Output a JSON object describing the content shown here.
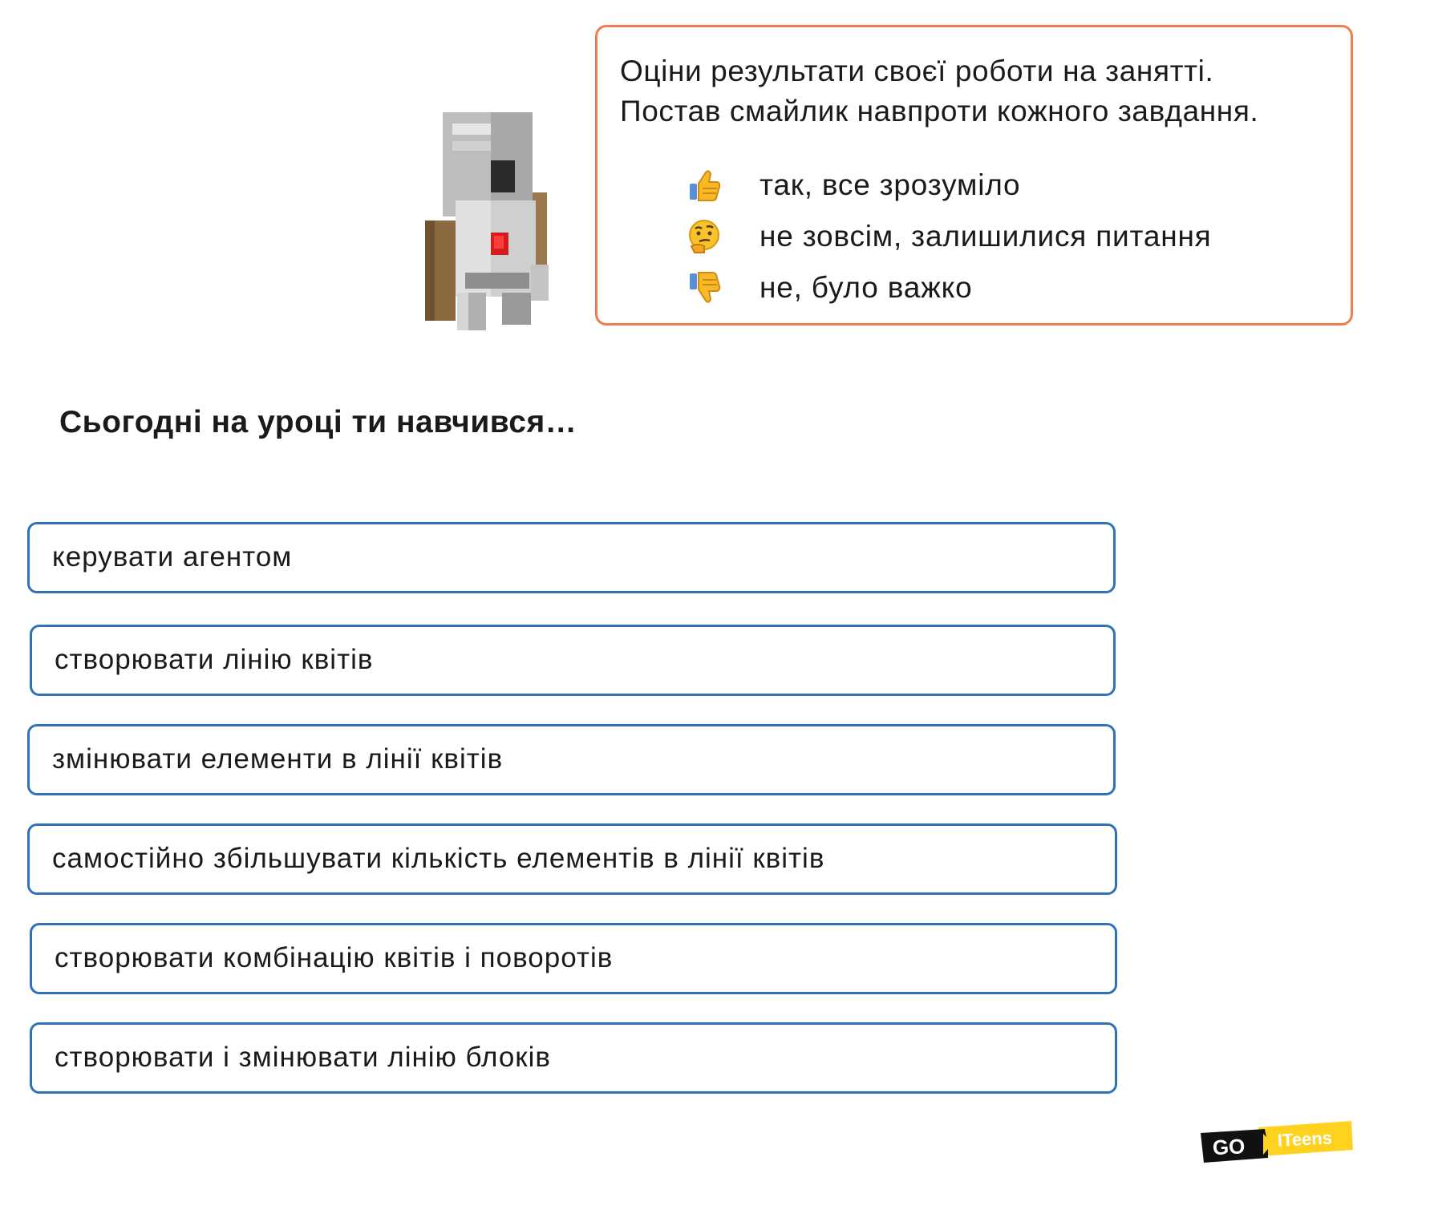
{
  "instructions": {
    "line1": "Оціни результати своєї роботи на занятті.",
    "line2": "Постав смайлик навпроти кожного завдання.",
    "legend": [
      {
        "icon": "thumbs-up-icon",
        "text": "так, все зрозуміло"
      },
      {
        "icon": "thinking-face-icon",
        "text": "не зовсім, залишилися питання"
      },
      {
        "icon": "thumbs-down-icon",
        "text": "не, було важко"
      }
    ]
  },
  "heading": "Сьогодні на уроці ти навчився…",
  "items": [
    "керувати агентом",
    "створювати лінію квітів",
    "змінювати елементи в лінії квітів",
    "самостійно збільшувати кількість елементів в лінії квітів",
    "створювати комбінацію квітів і поворотів",
    "створювати і змінювати лінію блоків"
  ],
  "logo": {
    "left": "GO",
    "right": "ITeens"
  },
  "colors": {
    "card_border": "#ef7d4f",
    "item_border": "#2f72b8",
    "logo_yellow": "#ffd21f",
    "logo_black": "#111111"
  }
}
